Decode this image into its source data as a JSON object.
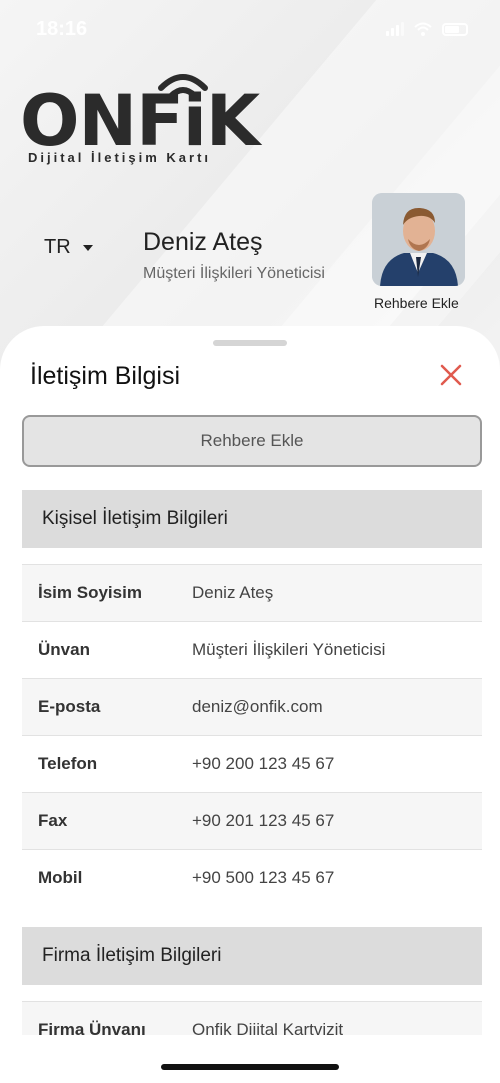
{
  "status_bar": {
    "time": "18:16"
  },
  "logo": {
    "word": "ONFiK",
    "tagline": "Dijital İletişim Kartı"
  },
  "profile": {
    "language": "TR",
    "name": "Deniz Ateş",
    "title": "Müşteri İlişkileri Yöneticisi",
    "avatar_label": "Rehbere Ekle"
  },
  "sheet": {
    "title": "İletişim Bilgisi",
    "add_contact_label": "Rehbere Ekle",
    "accent_color": "#e05a4e"
  },
  "personal": {
    "header": "Kişisel İletişim Bilgileri",
    "rows": [
      {
        "label": "İsim Soyisim",
        "value": "Deniz Ateş"
      },
      {
        "label": "Ünvan",
        "value": "Müşteri İlişkileri Yöneticisi"
      },
      {
        "label": "E-posta",
        "value": "deniz@onfik.com"
      },
      {
        "label": "Telefon",
        "value": "+90 200 123 45 67"
      },
      {
        "label": "Fax",
        "value": "+90 201 123 45 67"
      },
      {
        "label": "Mobil",
        "value": "+90 500 123 45 67"
      }
    ]
  },
  "company": {
    "header": "Firma İletişim Bilgileri",
    "rows": [
      {
        "label": "Firma Ünvanı",
        "value": "Onfik Dijital Kartvizit"
      }
    ]
  }
}
